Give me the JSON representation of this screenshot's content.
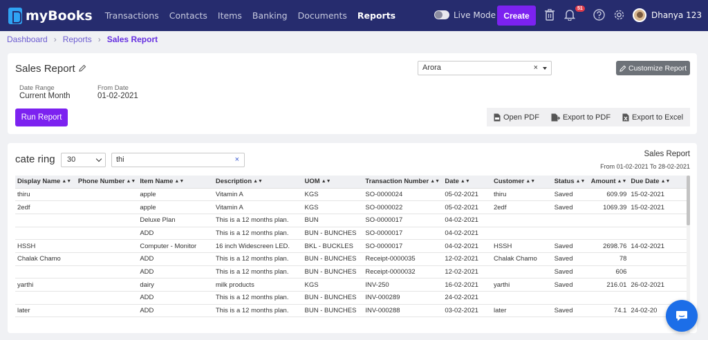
{
  "app": {
    "name": "myBooks"
  },
  "nav": {
    "items": [
      {
        "label": "Transactions",
        "active": false
      },
      {
        "label": "Contacts",
        "active": false
      },
      {
        "label": "Items",
        "active": false
      },
      {
        "label": "Banking",
        "active": false
      },
      {
        "label": "Documents",
        "active": false
      },
      {
        "label": "Reports",
        "active": true
      }
    ]
  },
  "topbar": {
    "live_mode_label": "Live Mode",
    "create_label": "Create",
    "notification_count": "51",
    "user_name": "Dhanya 123"
  },
  "breadcrumb": {
    "items": [
      "Dashboard",
      "Reports"
    ],
    "current": "Sales Report"
  },
  "report": {
    "title": "Sales Report",
    "customer_select": "Arora",
    "customize_label": "Customize Report",
    "date_range_label": "Date Range",
    "date_range_value": "Current Month",
    "from_date_label": "From Date",
    "from_date_value": "01-02-2021",
    "run_label": "Run Report",
    "export": {
      "open_pdf": "Open PDF",
      "export_pdf": "Export to PDF",
      "export_excel": "Export to Excel"
    }
  },
  "table_section": {
    "title": "cate ring",
    "page_size": "30",
    "search_value": "thi",
    "report_title": "Sales Report",
    "report_range": "From 01-02-2021 To 28-02-2021"
  },
  "table": {
    "columns": [
      "Display Name",
      "Phone Number",
      "Item Name",
      "Description",
      "UOM",
      "Transaction Number",
      "Date",
      "Customer",
      "Status",
      "Amount",
      "Due Date"
    ],
    "rows": [
      [
        "thiru",
        "",
        "apple",
        "Vitamin A",
        "KGS",
        "SO-0000024",
        "05-02-2021",
        "thiru",
        "Saved",
        "609.99",
        "15-02-2021"
      ],
      [
        "2edf",
        "",
        "apple",
        "Vitamin A",
        "KGS",
        "SO-0000022",
        "05-02-2021",
        "2edf",
        "Saved",
        "1069.39",
        "15-02-2021"
      ],
      [
        "",
        "",
        "Deluxe Plan",
        "This is a 12 months plan.",
        "BUN",
        "SO-0000017",
        "04-02-2021",
        "",
        "",
        "",
        ""
      ],
      [
        "",
        "",
        "ADD",
        "This is a 12 months plan.",
        "BUN - BUNCHES",
        "SO-0000017",
        "04-02-2021",
        "",
        "",
        "",
        ""
      ],
      [
        "HSSH",
        "",
        "Computer - Monitor",
        "16 inch Widescreen LED.",
        "BKL - BUCKLES",
        "SO-0000017",
        "04-02-2021",
        "HSSH",
        "Saved",
        "2698.76",
        "14-02-2021"
      ],
      [
        "Chalak Chamo",
        "",
        "ADD",
        "This is a 12 months plan.",
        "BUN - BUNCHES",
        "Receipt-0000035",
        "12-02-2021",
        "Chalak Chamo",
        "Saved",
        "78",
        ""
      ],
      [
        "",
        "",
        "ADD",
        "This is a 12 months plan.",
        "BUN - BUNCHES",
        "Receipt-0000032",
        "12-02-2021",
        "",
        "Saved",
        "606",
        ""
      ],
      [
        "yarthi",
        "",
        "dairy",
        "milk products",
        "KGS",
        "INV-250",
        "16-02-2021",
        "yarthi",
        "Saved",
        "216.01",
        "26-02-2021"
      ],
      [
        "",
        "",
        "ADD",
        "This is a 12 months plan.",
        "BUN - BUNCHES",
        "INV-000289",
        "24-02-2021",
        "",
        "",
        "",
        ""
      ],
      [
        "later",
        "",
        "ADD",
        "This is a 12 months plan.",
        "BUN - BUNCHES",
        "INV-000288",
        "03-02-2021",
        "later",
        "Saved",
        "74.1",
        "24-02-20"
      ]
    ]
  }
}
